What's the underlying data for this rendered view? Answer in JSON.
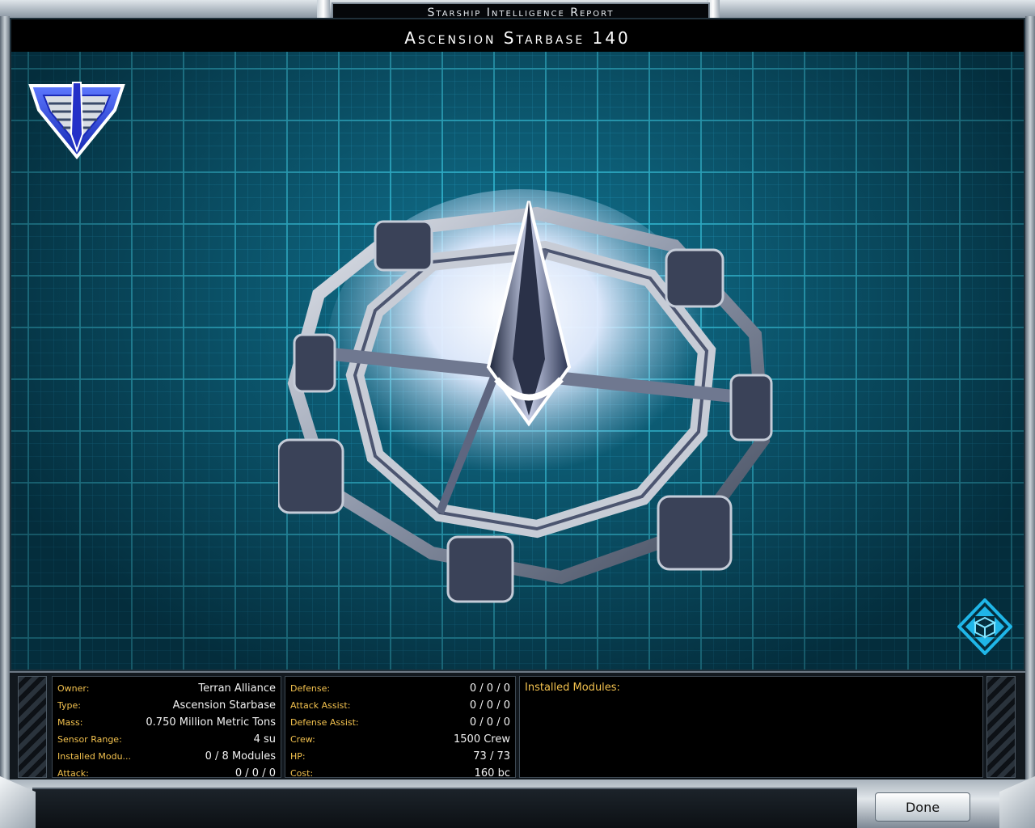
{
  "window": {
    "header_title": "Starship Intelligence Report",
    "ship_name": "Ascension Starbase 140"
  },
  "icons": {
    "faction_logo": "terran-alliance-shield-icon",
    "rotate_view": "rotate-view-icon",
    "ship_model": "ascension-starbase-model"
  },
  "stats_left": [
    {
      "label": "Owner:",
      "value": "Terran Alliance"
    },
    {
      "label": "Type:",
      "value": "Ascension Starbase"
    },
    {
      "label": "Mass:",
      "value": "0.750 Million Metric Tons"
    },
    {
      "label": "Sensor Range:",
      "value": "4 su"
    },
    {
      "label": "Installed Modu...",
      "value": "0 / 8 Modules"
    },
    {
      "label": "Attack:",
      "value": "0 / 0 / 0"
    }
  ],
  "stats_right": [
    {
      "label": "Defense:",
      "value": "0 / 0 / 0"
    },
    {
      "label": "Attack Assist:",
      "value": "0 / 0 / 0"
    },
    {
      "label": "Defense Assist:",
      "value": "0 / 0 / 0"
    },
    {
      "label": "Crew:",
      "value": "1500 Crew"
    },
    {
      "label": "HP:",
      "value": "73 / 73"
    },
    {
      "label": "Cost:",
      "value": "160 bc"
    }
  ],
  "modules": {
    "title": "Installed Modules:"
  },
  "buttons": {
    "done_label": "Done"
  },
  "colors": {
    "label": "#f2c14e",
    "grid": "#46e6ff",
    "faction_blue": "#2a3fd8"
  }
}
